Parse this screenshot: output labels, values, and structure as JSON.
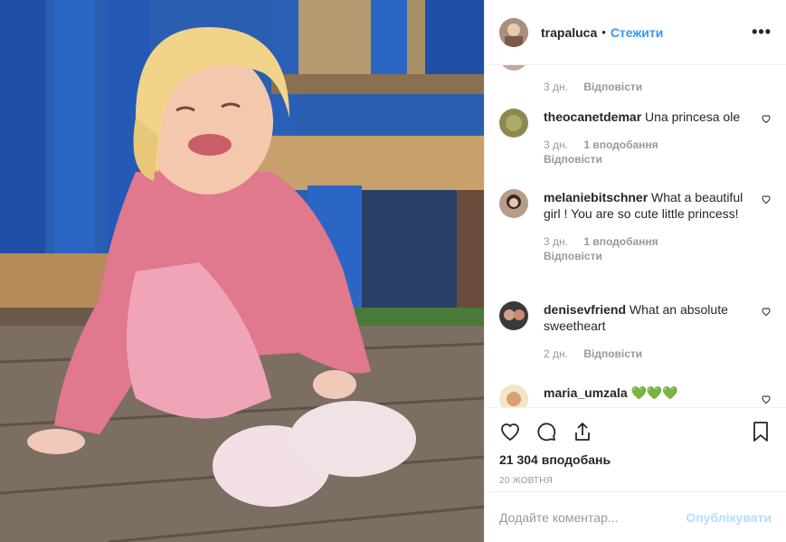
{
  "header": {
    "username": "trapaluca",
    "separator": "•",
    "follow_label": "Стежити",
    "more_label": "•••"
  },
  "comments": [
    {
      "username": "",
      "text": "",
      "time": "3 дн.",
      "likes": "",
      "reply": "Відповісти"
    },
    {
      "username": "theocanetdemar",
      "text": "Una princesa ole",
      "time": "3 дн.",
      "likes": "1 вподобання",
      "reply": "Відповісти"
    },
    {
      "username": "melaniebitschner",
      "text": "What a beautiful girl ! You are so cute little princess!",
      "time": "3 дн.",
      "likes": "1 вподобання",
      "reply": "Відповісти"
    },
    {
      "username": "denisevfriend",
      "text": "What an absolute sweetheart",
      "time": "2 дн.",
      "likes": "",
      "reply": "Відповісти"
    },
    {
      "username": "maria_umzala",
      "text": "💚💚💚",
      "time": "",
      "likes": "",
      "reply": ""
    }
  ],
  "footer": {
    "likes_count": "21 304 вподобань",
    "date": "20 жовтня",
    "comment_placeholder": "Додайте коментар...",
    "publish_label": "Опублікувати"
  },
  "icons": {
    "heart": "heart-icon",
    "comment": "comment-icon",
    "share": "share-icon",
    "bookmark": "bookmark-icon",
    "more": "more-icon"
  },
  "colors": {
    "link": "#3897f0",
    "publish_disabled": "#b2dffc",
    "muted": "#999999",
    "text": "#262626"
  }
}
